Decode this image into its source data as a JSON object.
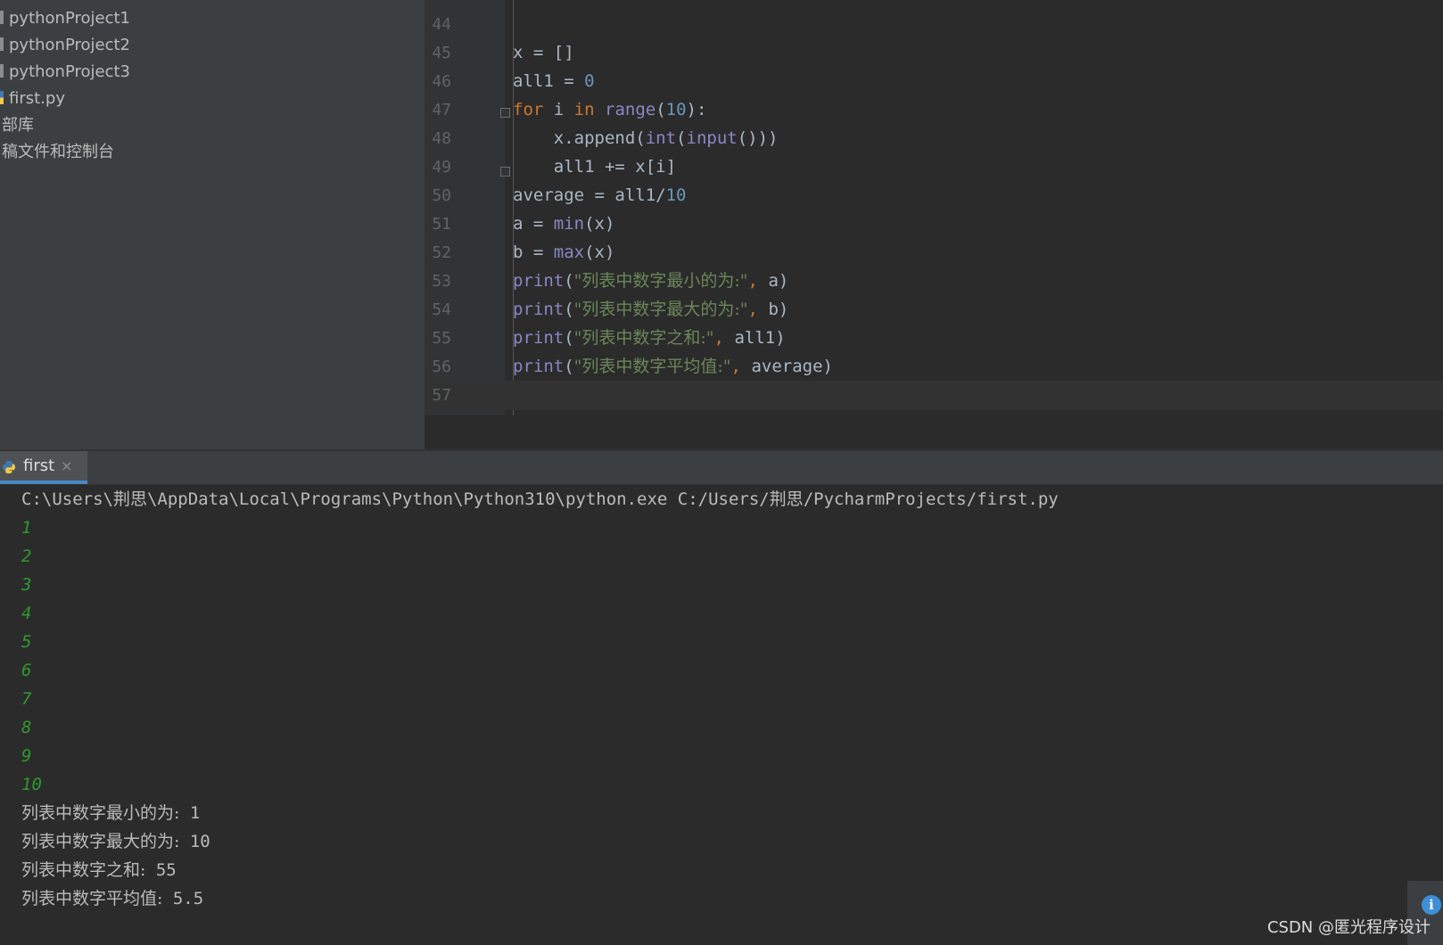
{
  "sidebar": {
    "items": [
      {
        "label": "pythonProject1",
        "kind": "folder"
      },
      {
        "label": "pythonProject2",
        "kind": "folder"
      },
      {
        "label": "pythonProject3",
        "kind": "folder"
      },
      {
        "label": "first.py",
        "kind": "python-file"
      },
      {
        "label": "部库",
        "kind": "plain"
      },
      {
        "label": "稿文件和控制台",
        "kind": "plain"
      }
    ]
  },
  "editor": {
    "lines": [
      {
        "no": "44"
      },
      {
        "no": "45",
        "tokens": [
          [
            "x = []",
            "plain"
          ]
        ]
      },
      {
        "no": "46",
        "tokens": [
          [
            "all1 = ",
            "plain"
          ],
          [
            "0",
            "num"
          ]
        ]
      },
      {
        "no": "47",
        "tokens": [
          [
            "for",
            "kw"
          ],
          [
            " i ",
            "plain"
          ],
          [
            "in",
            "kw"
          ],
          [
            " ",
            "plain"
          ],
          [
            "range",
            "builtin"
          ],
          [
            "(",
            "plain"
          ],
          [
            "10",
            "num"
          ],
          [
            "):",
            "plain"
          ]
        ]
      },
      {
        "no": "48",
        "tokens": [
          [
            "    x.append(",
            "plain"
          ],
          [
            "int",
            "builtin"
          ],
          [
            "(",
            "plain"
          ],
          [
            "input",
            "builtin"
          ],
          [
            "()))",
            "plain"
          ]
        ]
      },
      {
        "no": "49",
        "tokens": [
          [
            "    all1 += x[i]",
            "plain"
          ]
        ]
      },
      {
        "no": "50",
        "tokens": [
          [
            "average = all1/",
            "plain"
          ],
          [
            "10",
            "num"
          ]
        ]
      },
      {
        "no": "51",
        "tokens": [
          [
            "a = ",
            "plain"
          ],
          [
            "min",
            "builtin"
          ],
          [
            "(x)",
            "plain"
          ]
        ]
      },
      {
        "no": "52",
        "tokens": [
          [
            "b = ",
            "plain"
          ],
          [
            "max",
            "builtin"
          ],
          [
            "(x)",
            "plain"
          ]
        ]
      },
      {
        "no": "53",
        "tokens": [
          [
            "print",
            "builtin"
          ],
          [
            "(",
            "plain"
          ],
          [
            "\"列表中数字最小的为:\"",
            "str"
          ],
          [
            ", ",
            "kw"
          ],
          [
            "a)",
            "plain"
          ]
        ]
      },
      {
        "no": "54",
        "tokens": [
          [
            "print",
            "builtin"
          ],
          [
            "(",
            "plain"
          ],
          [
            "\"列表中数字最大的为:\"",
            "str"
          ],
          [
            ", ",
            "kw"
          ],
          [
            "b)",
            "plain"
          ]
        ]
      },
      {
        "no": "55",
        "tokens": [
          [
            "print",
            "builtin"
          ],
          [
            "(",
            "plain"
          ],
          [
            "\"列表中数字之和:\"",
            "str"
          ],
          [
            ", ",
            "kw"
          ],
          [
            "all1)",
            "plain"
          ]
        ]
      },
      {
        "no": "56",
        "tokens": [
          [
            "print",
            "builtin"
          ],
          [
            "(",
            "plain"
          ],
          [
            "\"列表中数字平均值:\"",
            "str"
          ],
          [
            ", ",
            "kw"
          ],
          [
            "average)",
            "plain"
          ]
        ]
      },
      {
        "no": "57",
        "current": true
      }
    ]
  },
  "run": {
    "tab_label": "first",
    "close_glyph": "×",
    "command": "C:\\Users\\荆思\\AppData\\Local\\Programs\\Python\\Python310\\python.exe C:/Users/荆思/PycharmProjects/first.py",
    "inputs": [
      "1",
      "2",
      "3",
      "4",
      "5",
      "6",
      "7",
      "8",
      "9",
      "10"
    ],
    "outputs": [
      {
        "label": "列表中数字最小的为:",
        "value": " 1"
      },
      {
        "label": "列表中数字最大的为:",
        "value": " 10"
      },
      {
        "label": "列表中数字之和:",
        "value": " 55"
      },
      {
        "label": "列表中数字平均值:",
        "value": " 5.5"
      }
    ]
  },
  "watermark": "CSDN @匿光程序设计",
  "info_glyph": "i",
  "colors": {
    "keyword": "#cc7832",
    "number": "#6897bb",
    "builtin": "#8888c6",
    "string": "#6a8759",
    "input_echo": "#2e9a2e",
    "accent": "#4a88c7"
  }
}
